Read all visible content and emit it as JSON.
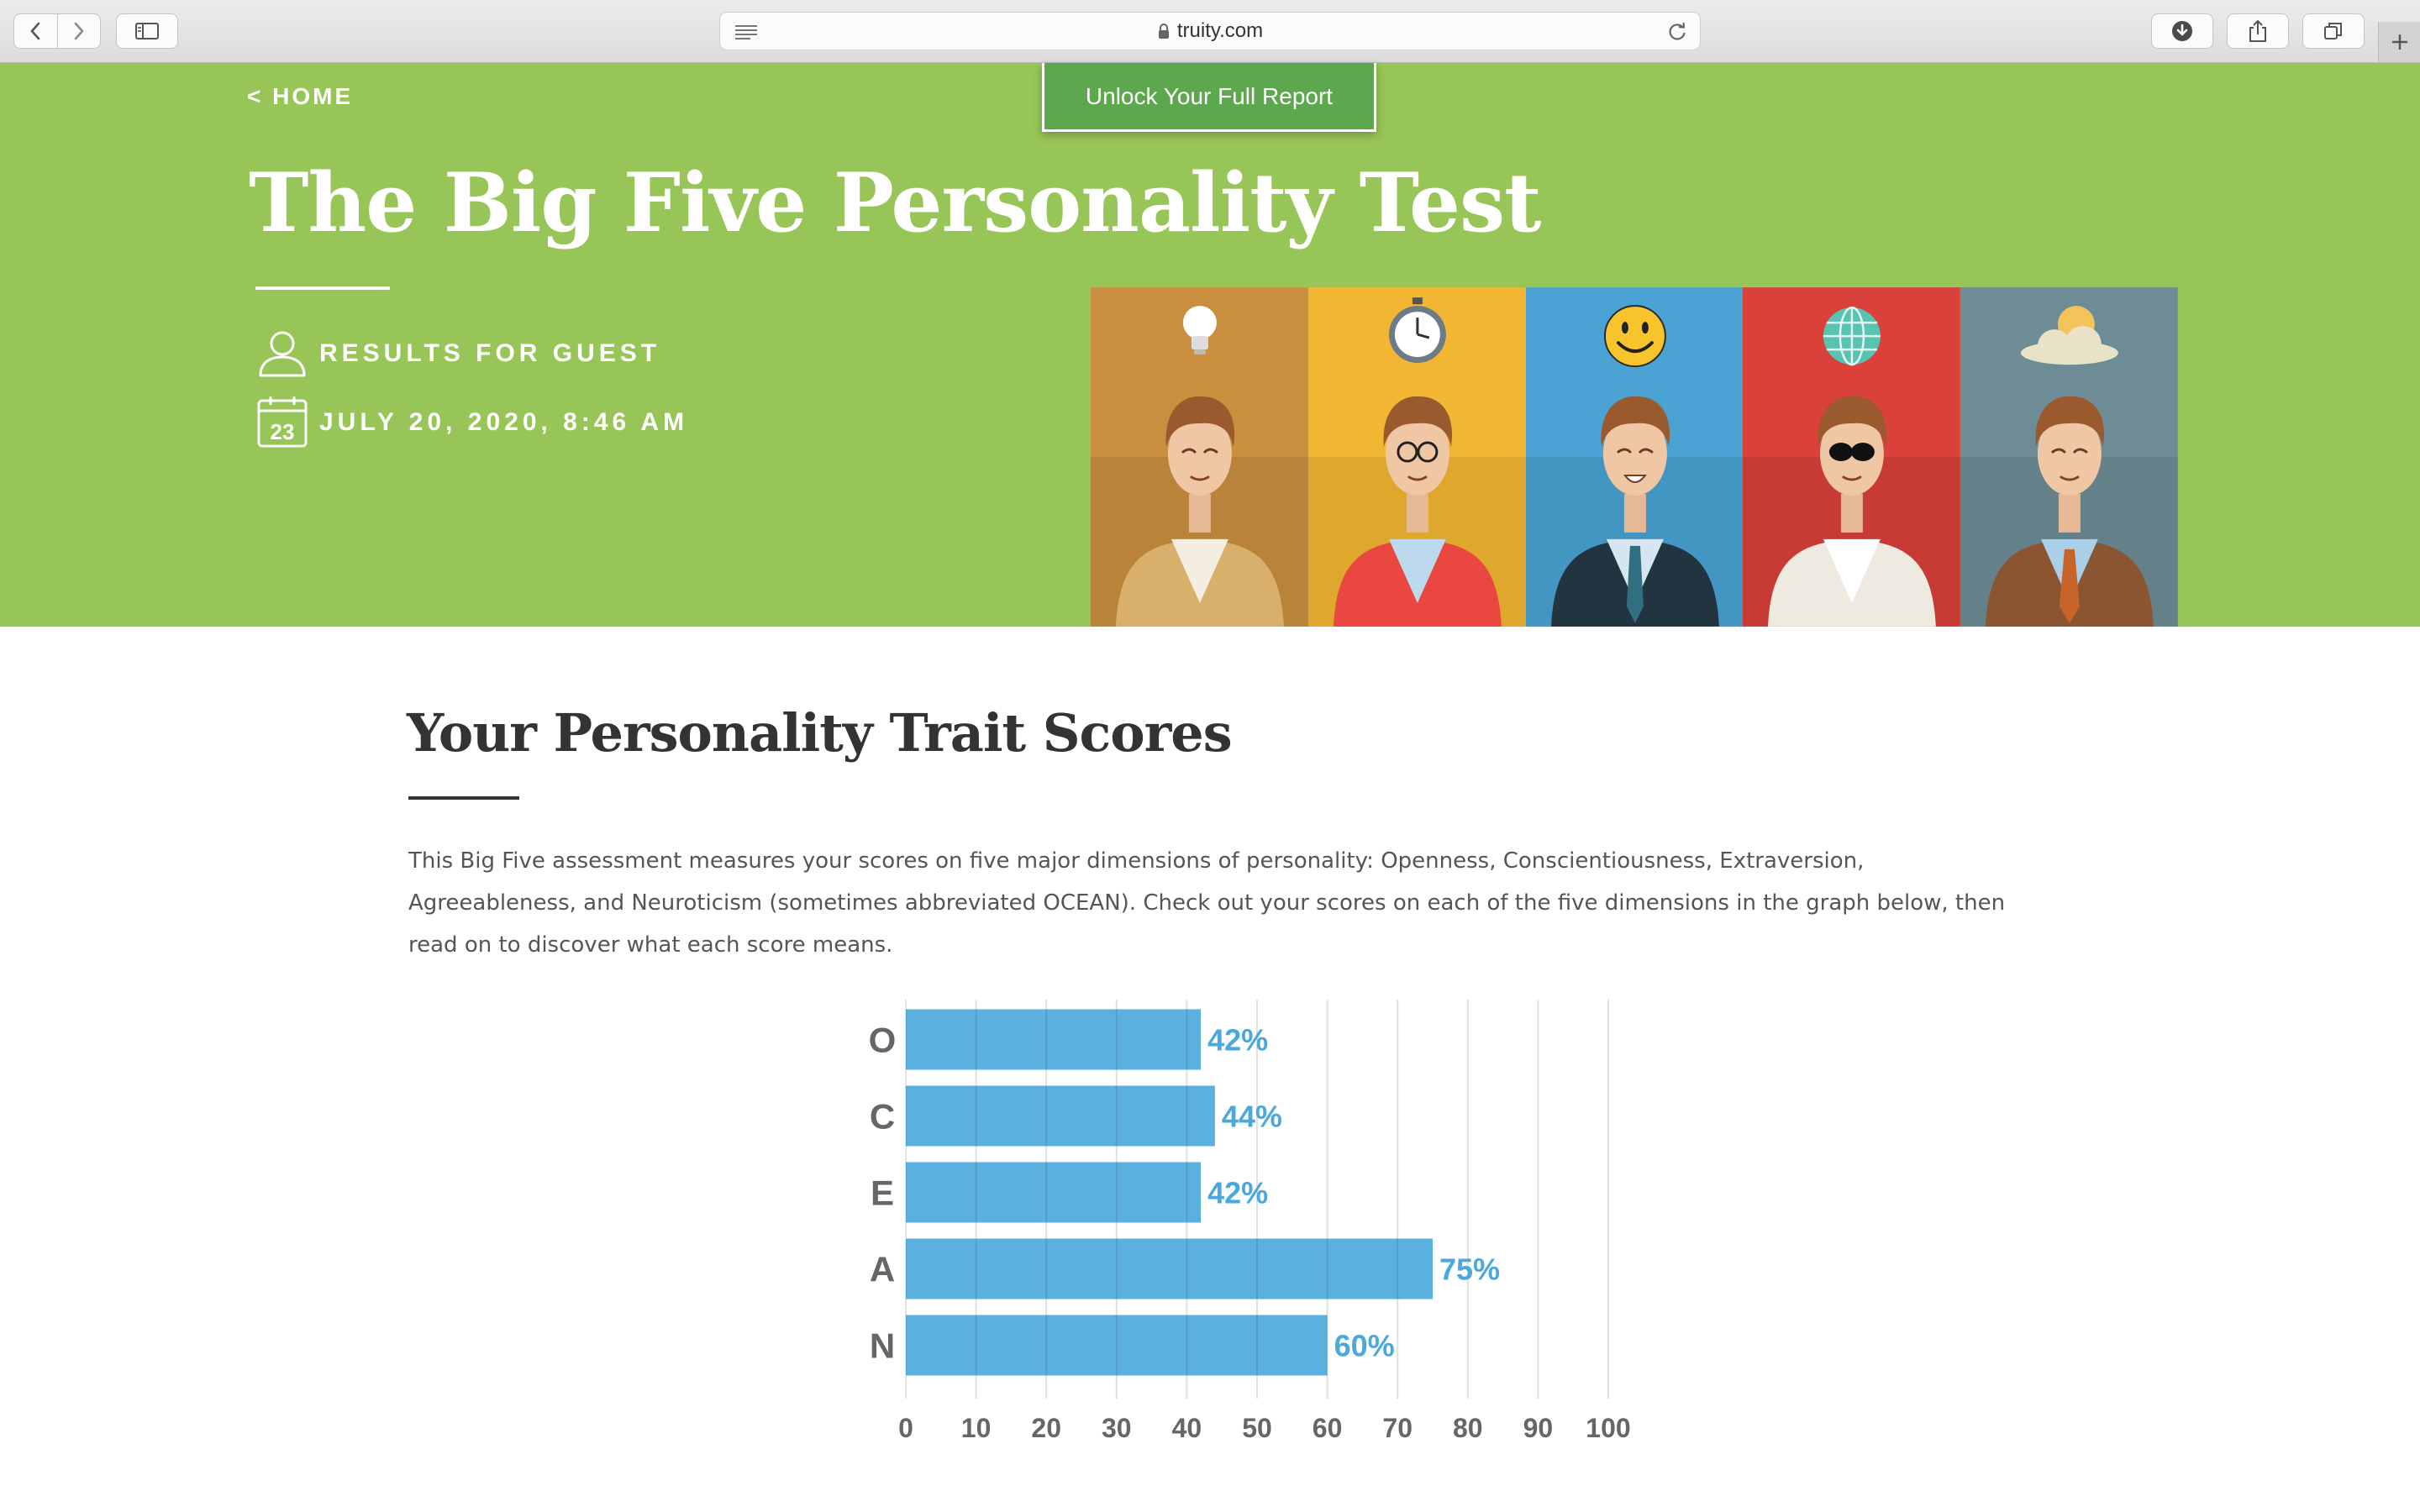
{
  "browser": {
    "url": "truity.com",
    "icons": {
      "back": "chevron-left-icon",
      "forward": "chevron-right-icon",
      "sidebar": "sidebar-icon",
      "reader": "reader-icon",
      "lock": "lock-icon",
      "reload": "reload-icon",
      "download": "download-icon",
      "share": "share-icon",
      "tabs": "tabs-icon",
      "new_tab": "plus-icon"
    }
  },
  "hero": {
    "home_link": "< HOME",
    "unlock_button": "Unlock Your Full Report",
    "title": "The Big Five Personality Test",
    "results_for": "RESULTS FOR GUEST",
    "date": "JULY 20, 2020, 8:46 AM",
    "calendar_day": "23",
    "background_color": "#98c557",
    "trait_panels": [
      {
        "icon": "lightbulb-icon",
        "color": "#c98f3e"
      },
      {
        "icon": "stopwatch-icon",
        "color": "#f2b632"
      },
      {
        "icon": "smiley-icon",
        "color": "#4aa3d3"
      },
      {
        "icon": "globe-icon",
        "color": "#d9413a"
      },
      {
        "icon": "sun-cloud-icon",
        "color": "#6d8c95"
      }
    ]
  },
  "main": {
    "section_title": "Your Personality Trait Scores",
    "intro": "This Big Five assessment measures your scores on five major dimensions of personality: Openness, Conscientiousness, Extraversion, Agreeableness, and Neuroticism (sometimes abbreviated OCEAN). Check out your scores on each of the five dimensions in the graph below, then read on to discover what each score means."
  },
  "chart_data": {
    "type": "bar",
    "orientation": "horizontal",
    "categories": [
      "O",
      "C",
      "E",
      "A",
      "N"
    ],
    "values": [
      42,
      44,
      42,
      75,
      60
    ],
    "value_labels": [
      "42%",
      "44%",
      "42%",
      "75%",
      "60%"
    ],
    "xlim": [
      0,
      100
    ],
    "xticks": [
      "0",
      "10",
      "20",
      "30",
      "40",
      "50",
      "60",
      "70",
      "80",
      "90",
      "100"
    ],
    "grid": true,
    "bar_color": "#5ab0df",
    "label_color": "#4aa8dc"
  }
}
